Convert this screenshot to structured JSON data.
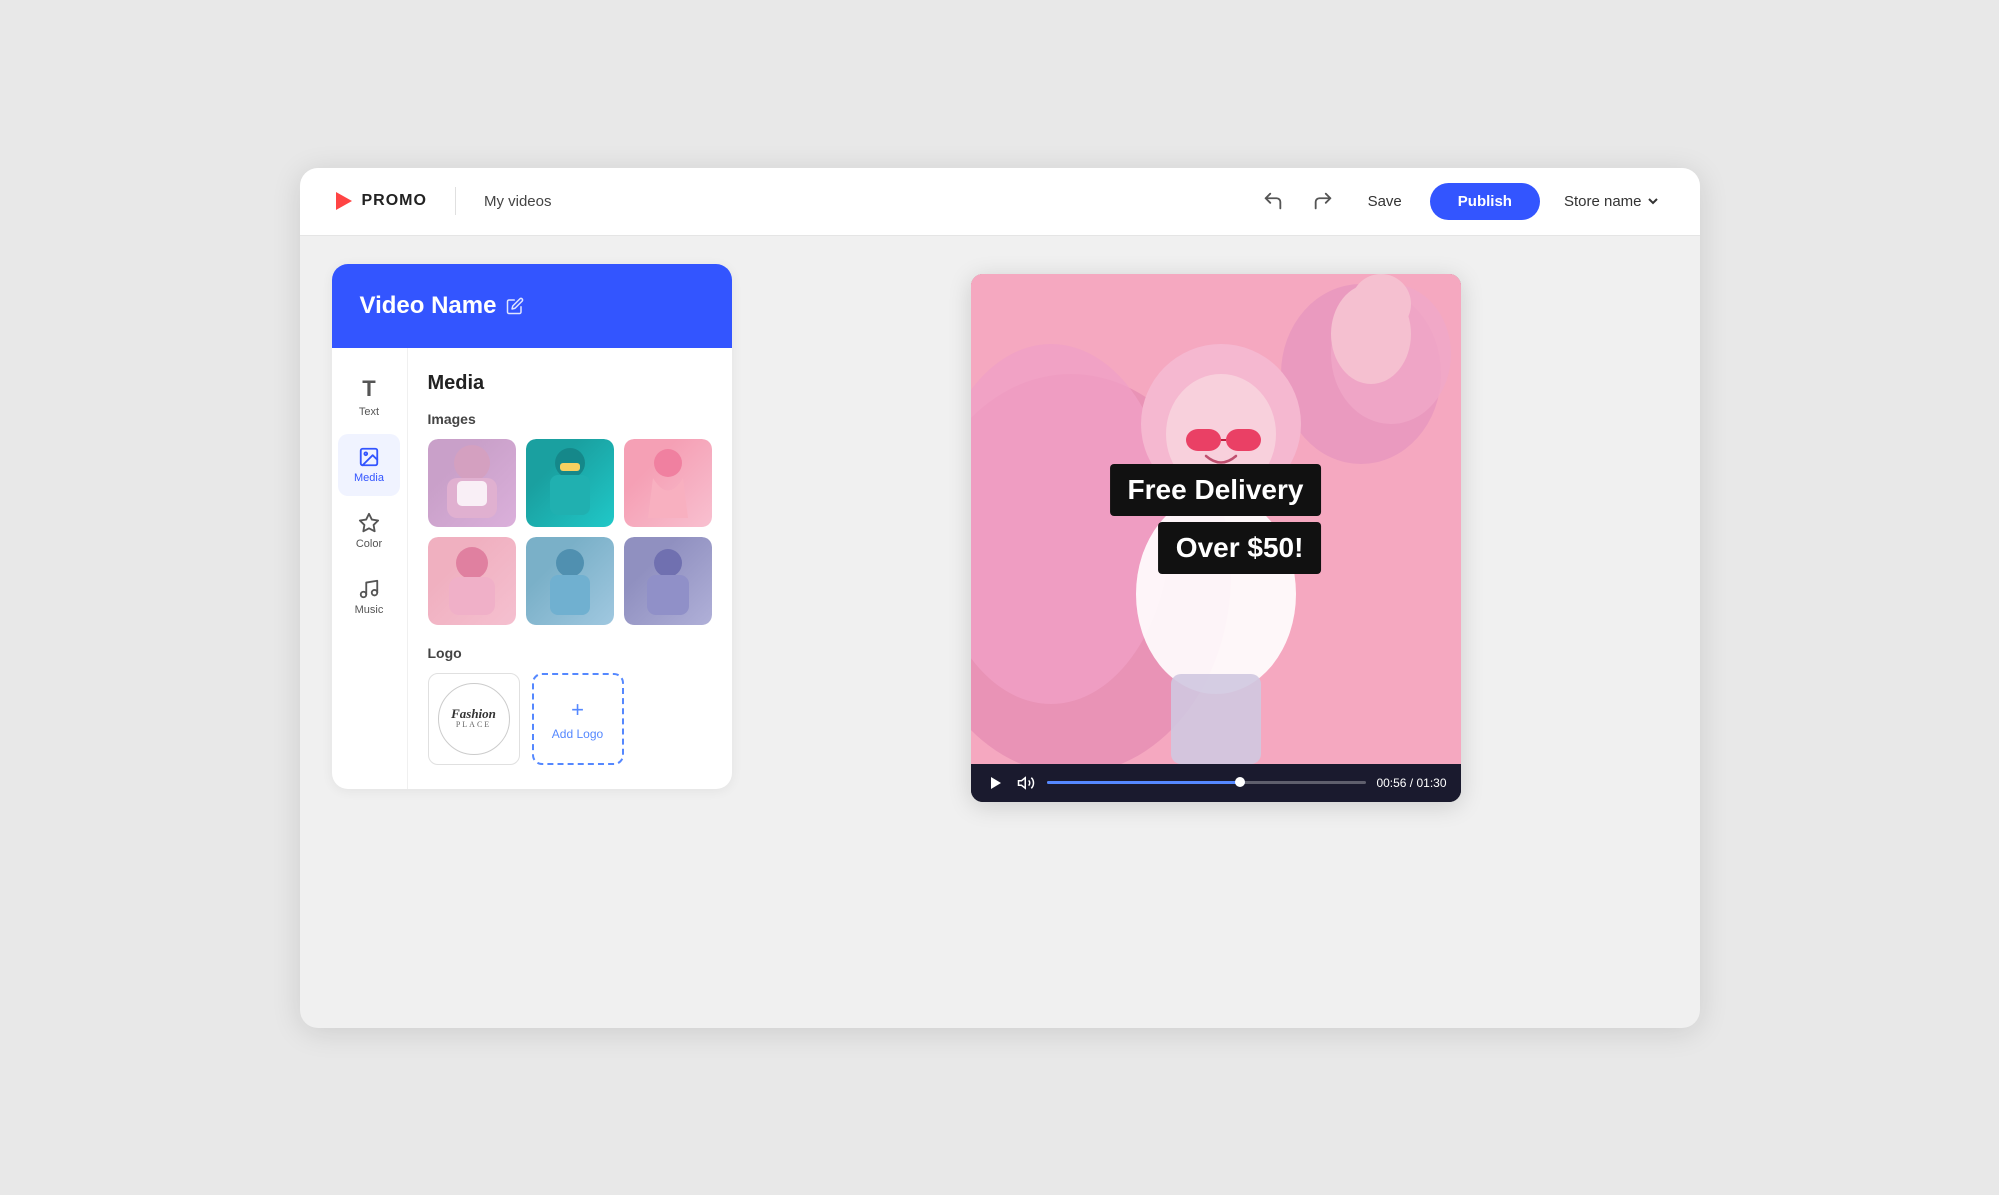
{
  "header": {
    "logo_text": "PROMO",
    "nav_link": "My videos",
    "save_label": "Save",
    "publish_label": "Publish",
    "store_name_label": "Store name"
  },
  "left_panel": {
    "video_name": "Video Name",
    "sidebar": {
      "items": [
        {
          "id": "text",
          "label": "Text",
          "icon": "T"
        },
        {
          "id": "media",
          "label": "Media",
          "icon": "media"
        },
        {
          "id": "color",
          "label": "Color",
          "icon": "color"
        },
        {
          "id": "music",
          "label": "Music",
          "icon": "music"
        }
      ]
    },
    "media_section": {
      "title": "Media",
      "images_label": "Images",
      "images": [
        {
          "id": 1,
          "class": "img1"
        },
        {
          "id": 2,
          "class": "img2"
        },
        {
          "id": 3,
          "class": "img3"
        },
        {
          "id": 4,
          "class": "img4"
        },
        {
          "id": 5,
          "class": "img5"
        },
        {
          "id": 6,
          "class": "img6"
        }
      ],
      "logo_label": "Logo",
      "fashion_logo_line1": "Fashion",
      "fashion_logo_line2": "PLACE",
      "add_logo_plus": "+",
      "add_logo_label": "Add Logo"
    }
  },
  "video_preview": {
    "text_line1": "Free Delivery",
    "text_line2": "Over $50!",
    "time_current": "00:56",
    "time_total": "01:30",
    "time_display": "00:56 / 01:30",
    "progress_percent": 62
  }
}
